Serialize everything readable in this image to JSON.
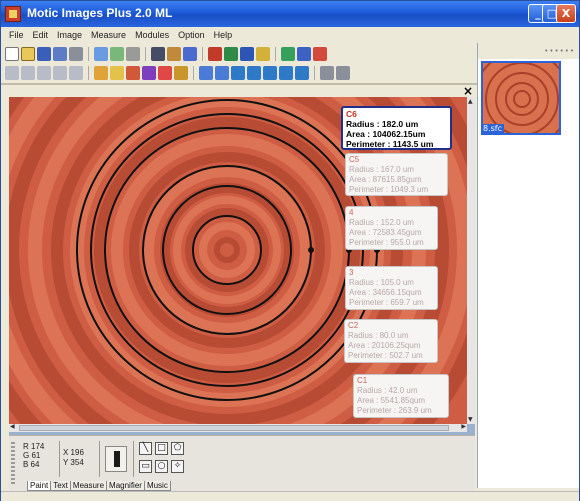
{
  "window": {
    "title": "Motic Images Plus 2.0 ML"
  },
  "title_buttons": {
    "minimize": "_",
    "maximize": "□",
    "close": "X"
  },
  "menu": [
    "File",
    "Edit",
    "Image",
    "Measure",
    "Modules",
    "Option",
    "Help"
  ],
  "document": {
    "close_glyph": "×"
  },
  "thumbnail": {
    "label": "8.sfc"
  },
  "annotations": [
    {
      "id": "C6",
      "title": "C6",
      "radius": "Radius : 182.0 um",
      "area": "Area : 104062.15um",
      "perimeter": "Perimeter : 1143.5 um",
      "active": true
    },
    {
      "id": "C5",
      "title": "C5",
      "radius": "Radius : 167.0 um",
      "area": "Area : 87615.85gum",
      "perimeter": "Perimeter : 1049.3 um",
      "active": false
    },
    {
      "id": "C4",
      "title": "4",
      "radius": "Radius : 152.0 um",
      "area": "Area : 72583.45gum",
      "perimeter": "Perimeter : 955.0 um",
      "active": false
    },
    {
      "id": "C3",
      "title": "3",
      "radius": "Radius : 105.0 um",
      "area": "Area : 34656.15qum",
      "perimeter": "Perimeter : 659.7 um",
      "active": false
    },
    {
      "id": "C2",
      "title": "C2",
      "radius": "Radius : 80.0 um",
      "area": "Area : 20106.25qum",
      "perimeter": "Perimeter : 502.7 um",
      "active": false
    },
    {
      "id": "C1",
      "title": "C1",
      "radius": "Radius : 42.0 um",
      "area": "Area : 5541.85qum",
      "perimeter": "Perimeter : 263.9 um",
      "active": false
    }
  ],
  "tool_panel": {
    "r": "R 174",
    "g": "G 61",
    "b": "B 64",
    "x": "X 196",
    "y": "Y 354",
    "tabs": [
      "Paint",
      "Text",
      "Measure",
      "Magnifier",
      "Music"
    ],
    "selected_tab": "Paint"
  },
  "colors": {
    "image_background": "#cf5d43",
    "ring_dark": "#a23a26",
    "ring_light": "#e27d5c",
    "accent": "#1c5ad8"
  }
}
